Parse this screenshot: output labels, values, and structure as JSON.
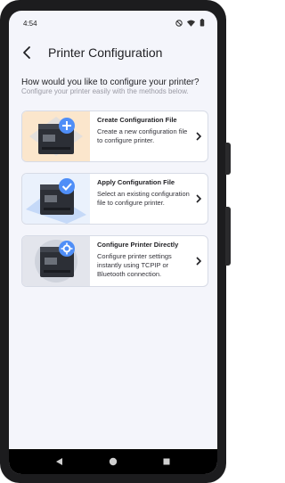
{
  "status": {
    "time": "4:54"
  },
  "header": {
    "title": "Printer Configuration"
  },
  "intro": {
    "question": "How would you like to configure your printer?",
    "subtitle": "Configure your printer easily with the methods below."
  },
  "options": [
    {
      "title": "Create Configuration File",
      "description": "Create a new configuration file to configure printer.",
      "accent": "#4f8ef7",
      "bg": "#fbe6cc"
    },
    {
      "title": "Apply Configuration File",
      "description": "Select an existing configuration file to configure printer.",
      "accent": "#4f8ef7",
      "bg": "#dbe8fb"
    },
    {
      "title": "Configure Printer Directly",
      "description": "Configure printer settings instantly using TCPIP or Bluetooth connection.",
      "accent": "#4f8ef7",
      "bg": "#e3e5ec"
    }
  ],
  "icons": {
    "back": "arrow-left",
    "chevron": "chevron-right",
    "status": [
      "dnd-icon",
      "wifi-icon",
      "battery-icon"
    ],
    "nav": [
      "back-triangle",
      "home-circle",
      "recents-square"
    ]
  }
}
